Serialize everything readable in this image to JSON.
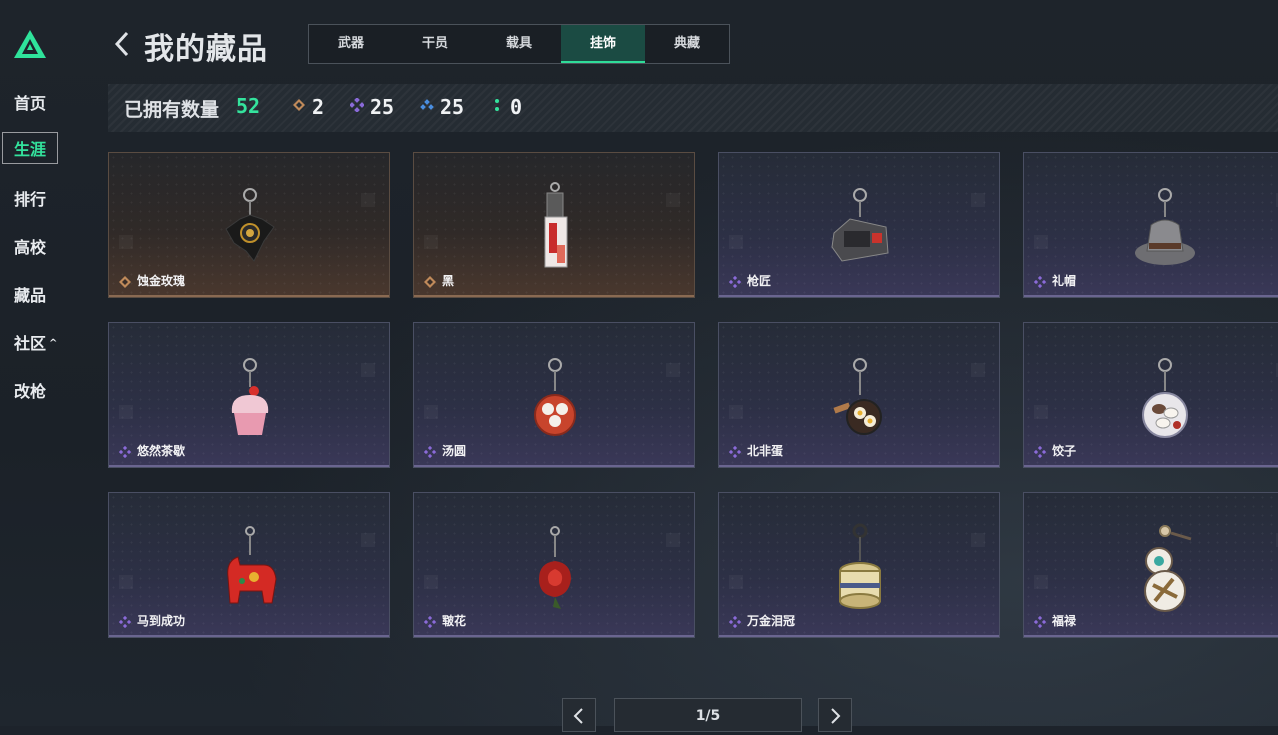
{
  "sidebar": {
    "items": [
      {
        "label": "首页"
      },
      {
        "label": "生涯"
      },
      {
        "label": "排行"
      },
      {
        "label": "高校"
      },
      {
        "label": "藏品"
      },
      {
        "label": "社区"
      },
      {
        "label": "改枪"
      }
    ],
    "active_index": 1,
    "community_chevron": "^"
  },
  "header": {
    "title": "我的藏品",
    "tabs": [
      "武器",
      "干员",
      "载具",
      "挂饰",
      "典藏"
    ],
    "active_tab": "挂饰"
  },
  "owned": {
    "label": "已拥有数量",
    "count": "52",
    "stats": [
      {
        "icon": "gold-diamond-icon",
        "color": "#c08a5a",
        "value": "2"
      },
      {
        "icon": "purple-diamond-icon",
        "color": "#8a6ad8",
        "value": "25"
      },
      {
        "icon": "blue-diamond-icon",
        "color": "#4a8ee0",
        "value": "25"
      },
      {
        "icon": "green-dots-icon",
        "color": "#34e39d",
        "value": "0"
      }
    ]
  },
  "items": [
    {
      "name": "蚀金玫瑰",
      "rarity": "gold"
    },
    {
      "name": "黑",
      "rarity": "gold"
    },
    {
      "name": "枪匠",
      "rarity": "purple"
    },
    {
      "name": "礼帽",
      "rarity": "purple"
    },
    {
      "name": "悠然茶歇",
      "rarity": "purple"
    },
    {
      "name": "汤圆",
      "rarity": "purple"
    },
    {
      "name": "北非蛋",
      "rarity": "purple"
    },
    {
      "name": "饺子",
      "rarity": "purple"
    },
    {
      "name": "马到成功",
      "rarity": "purple"
    },
    {
      "name": "皲花",
      "rarity": "purple"
    },
    {
      "name": "万金泪冠",
      "rarity": "purple"
    },
    {
      "name": "福禄",
      "rarity": "purple"
    }
  ],
  "pagination": {
    "page": "1/5"
  },
  "colors": {
    "accent": "#34e39d",
    "gold": "#c08a5a",
    "purple": "#8a6ad8",
    "blue": "#4a8ee0"
  }
}
